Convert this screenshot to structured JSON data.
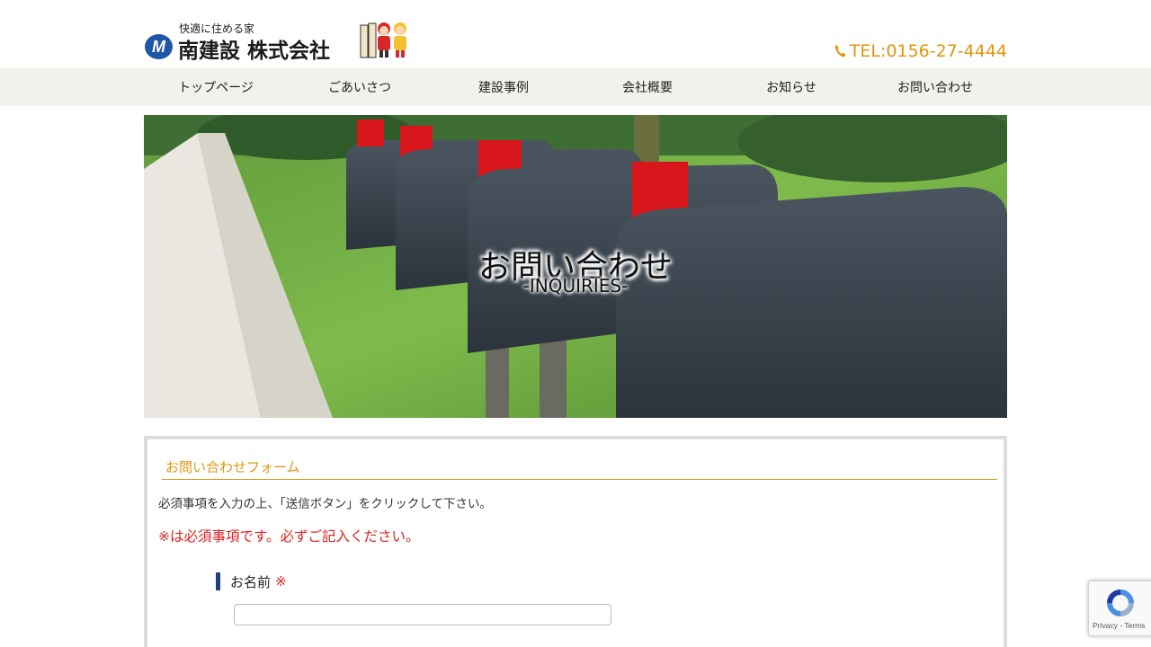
{
  "header": {
    "logo_tagline": "快適に住める家",
    "logo_name": "南建設 株式会社",
    "logo_mark": "M",
    "tel": "TEL:0156-27-4444",
    "tel_icon": "phone-icon",
    "accent_color": "#e0960e"
  },
  "nav": {
    "items": [
      {
        "label": "トップページ"
      },
      {
        "label": "ごあいさつ"
      },
      {
        "label": "建設事例"
      },
      {
        "label": "会社概要"
      },
      {
        "label": "お知らせ"
      },
      {
        "label": "お問い合わせ"
      }
    ]
  },
  "hero": {
    "title": "お問い合わせ",
    "subtitle": "-INQUIRIES-"
  },
  "form": {
    "heading": "お問い合わせフォーム",
    "intro": "必須事項を入力の上、「送信ボタン」をクリックして下さい。",
    "required_note": "※は必須事項です。必ずご記入ください。",
    "name_label": "お名前",
    "required_mark": "※",
    "name_value": "",
    "required_color": "#e02020"
  },
  "recaptcha": {
    "links": "Privacy - Terms"
  }
}
